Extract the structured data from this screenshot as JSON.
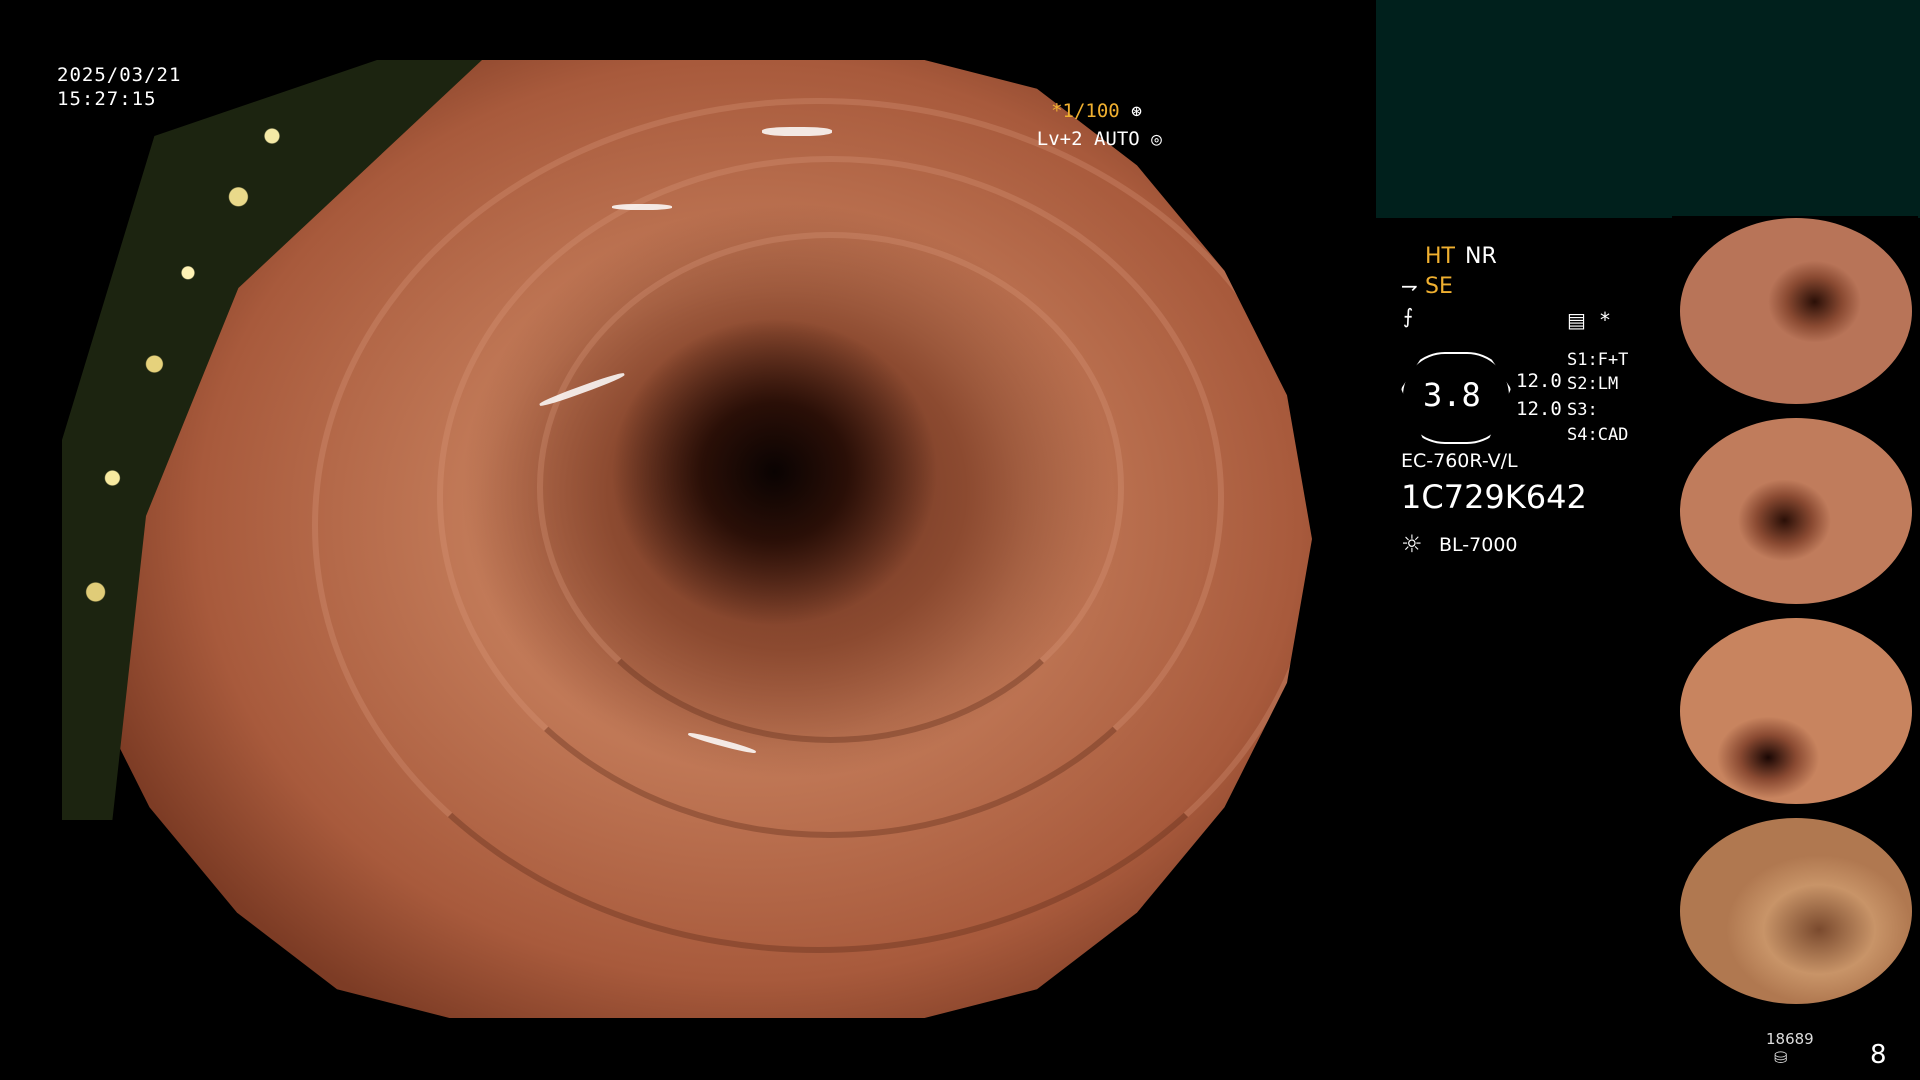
{
  "overlay": {
    "date": "2025/03/21",
    "time": "15:27:15",
    "shutter": "*1/100",
    "level": "Lv+2 AUTO",
    "shutter_icon": "aperture-icon",
    "auto_icon": "iris-icon"
  },
  "panel": {
    "ht": "HT",
    "nr": "NR",
    "se": "SE",
    "gauge_value": "3.8",
    "value_1": "12.0",
    "value_2": "12.0",
    "switches": [
      "S1:F+T",
      "S2:LM",
      "S3:",
      "S4:CAD"
    ],
    "scope_model": "EC-760R-V/L",
    "scope_serial": "1C729K642",
    "light_source": "BL-7000",
    "star": "*"
  },
  "footer": {
    "stored_images": "18689",
    "capture_count": "8"
  },
  "colors": {
    "accent_orange": "#f0b030",
    "panel_teal": "#00201c",
    "background": "#000000"
  }
}
